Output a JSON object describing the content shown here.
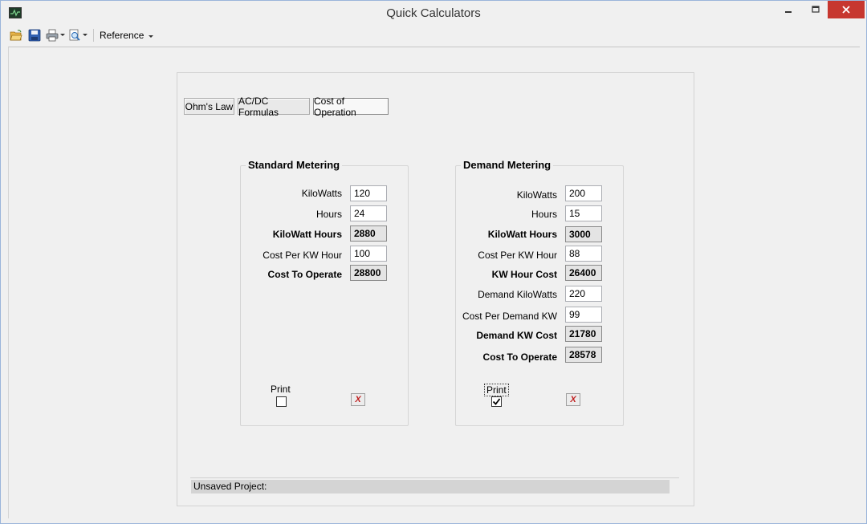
{
  "window": {
    "title": "Quick Calculators"
  },
  "toolbar": {
    "reference_label": "Reference"
  },
  "tabs": [
    {
      "label": "Ohm's Law",
      "active": false
    },
    {
      "label": "AC/DC Formulas",
      "active": false
    },
    {
      "label": "Cost of Operation",
      "active": true
    }
  ],
  "standard": {
    "title": "Standard Metering",
    "rows": [
      {
        "label": "KiloWatts",
        "value": "120",
        "result": false
      },
      {
        "label": "Hours",
        "value": "24",
        "result": false
      },
      {
        "label": "KiloWatt Hours",
        "value": "2880",
        "result": true
      },
      {
        "label": "Cost Per KW Hour",
        "value": "100",
        "result": false
      },
      {
        "label": "Cost To Operate",
        "value": "28800",
        "result": true
      }
    ],
    "print_label": "Print",
    "print_checked": false,
    "clear_symbol": "X"
  },
  "demand": {
    "title": "Demand Metering",
    "rows": [
      {
        "label": "KiloWatts",
        "value": "200",
        "result": false
      },
      {
        "label": "Hours",
        "value": "15",
        "result": false
      },
      {
        "label": "KiloWatt Hours",
        "value": "3000",
        "result": true
      },
      {
        "label": "Cost Per KW Hour",
        "value": "88",
        "result": false
      },
      {
        "label": "KW Hour Cost",
        "value": "26400",
        "result": true
      },
      {
        "label": "Demand KiloWatts",
        "value": "220",
        "result": false
      },
      {
        "label": "Cost Per Demand KW",
        "value": "99",
        "result": false
      },
      {
        "label": "Demand KW Cost",
        "value": "21780",
        "result": true
      },
      {
        "label": "Cost To Operate",
        "value": "28578",
        "result": true
      }
    ],
    "print_label": "Print",
    "print_checked": true,
    "clear_symbol": "X"
  },
  "status": {
    "text": "Unsaved Project:"
  },
  "colors": {
    "close_button": "#c7372f",
    "window_bg": "#f0f0f0",
    "result_bg": "#e4e4e4"
  }
}
